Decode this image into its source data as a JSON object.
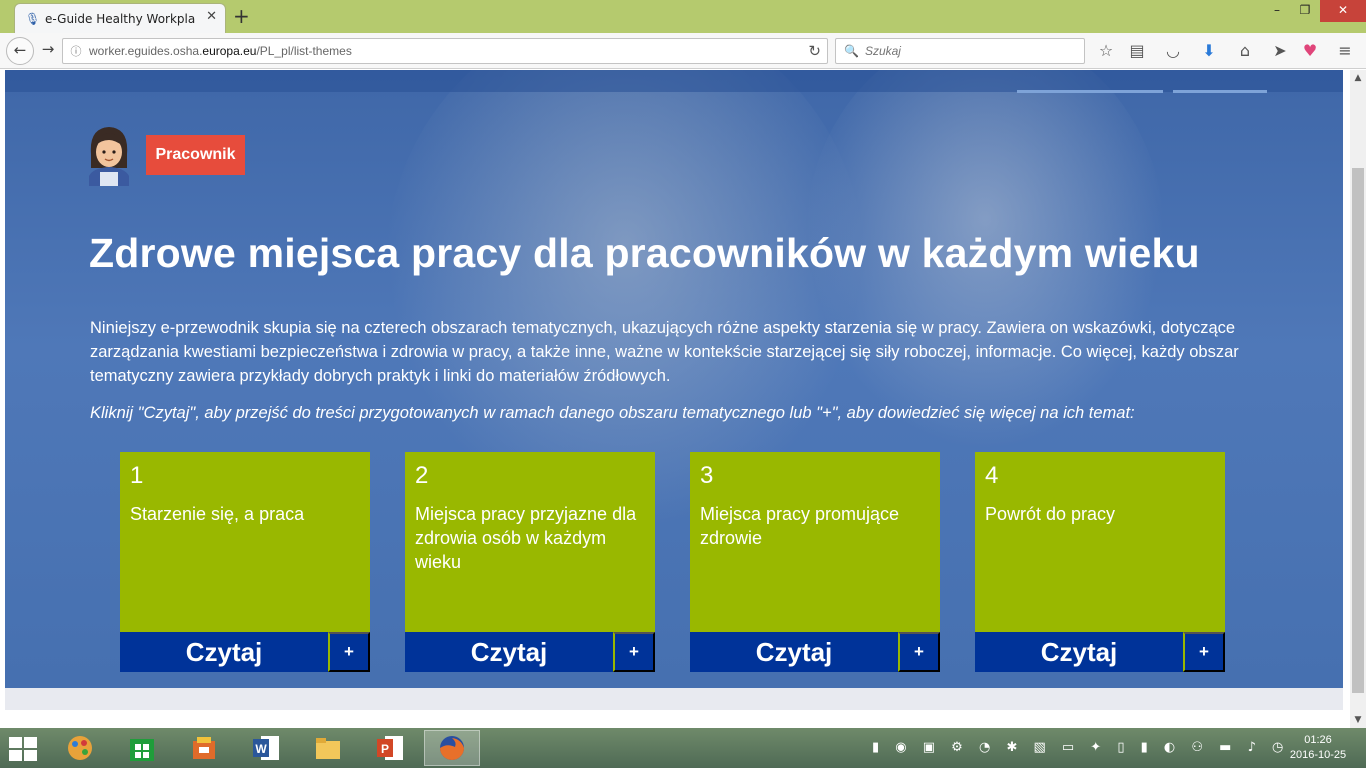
{
  "browser": {
    "tab_title": "e-Guide Healthy Workplac...",
    "tab_close": "✕",
    "new_tab": "+",
    "url_prefix": "worker.eguides.osha.",
    "url_domain": "europa.eu",
    "url_path": "/PL_pl/list-themes",
    "search_placeholder": "Szukaj",
    "window_controls": [
      "–",
      "❐",
      "✕"
    ]
  },
  "hero": {
    "role_badge": "Pracownik",
    "title": "Zdrowe miejsca pracy dla pracowników w każdym wieku",
    "description": "Niniejszy e-przewodnik skupia się na czterech obszarach tematycznych, ukazujących różne aspekty starzenia się w pracy. Zawiera on wskazówki, dotyczące zarządzania kwestiami bezpieczeństwa i zdrowia w pracy, a także inne, ważne w kontekście starzejącej się siły roboczej, informacje. Co więcej, każdy obszar tematyczny zawiera przykłady dobrych praktyk i linki do materiałów źródłowych.",
    "hint": "Kliknij \"Czytaj\", aby przejść do treści przygotowanych w ramach danego obszaru tematycznego lub \"+\", aby dowiedzieć się więcej na ich temat:"
  },
  "themes": [
    {
      "number": "1",
      "title": "Starzenie się, a praca",
      "read": "Czytaj",
      "more": "+"
    },
    {
      "number": "2",
      "title": "Miejsca pracy przyjazne dla zdrowia osób w każdym wieku",
      "read": "Czytaj",
      "more": "+"
    },
    {
      "number": "3",
      "title": "Miejsca pracy promujące zdrowie",
      "read": "Czytaj",
      "more": "+"
    },
    {
      "number": "4",
      "title": "Powrót do pracy",
      "read": "Czytaj",
      "more": "+"
    }
  ],
  "taskbar": {
    "time": "01:26",
    "date": "2016-10-25"
  },
  "colors": {
    "card_green": "#99b800",
    "button_blue": "#003399",
    "badge_red": "#e74c3c",
    "hero_blue": "#4670b0"
  }
}
